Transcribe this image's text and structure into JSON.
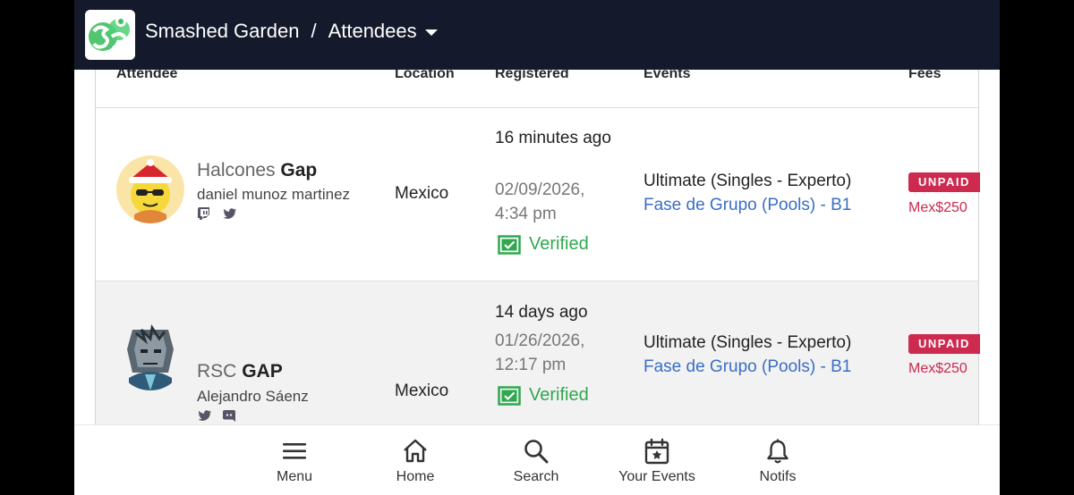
{
  "header": {
    "org": "Smashed Garden",
    "separator": "/",
    "section": "Attendees"
  },
  "table": {
    "columns": [
      "Attendee",
      "Location",
      "Registered",
      "Events",
      "Fees"
    ],
    "rows": [
      {
        "prefix": "Halcones",
        "gamertag": "Gap",
        "real_name": "daniel munoz martinez",
        "socials": [
          "twitch-icon",
          "twitter-icon"
        ],
        "location": "Mexico",
        "registered_relative": "16 minutes ago",
        "registered_date": "02/09/2026,",
        "registered_time": "4:34 pm",
        "verified": "Verified",
        "event": "Ultimate (Singles - Experto)",
        "phase": "Fase de Grupo (Pools) - B1",
        "status": "UNPAID",
        "fee": "Mex$250"
      },
      {
        "prefix": "RSC",
        "gamertag": "GAP",
        "real_name": "Alejandro Sáenz",
        "socials": [
          "twitter-icon",
          "discord-icon"
        ],
        "location": "Mexico",
        "registered_relative": "14 days ago",
        "registered_date": "01/26/2026,",
        "registered_time": "12:17 pm",
        "verified": "Verified",
        "event": "Ultimate (Singles - Experto)",
        "phase": "Fase de Grupo (Pools) - B1",
        "status": "UNPAID",
        "fee": "Mex$250"
      }
    ]
  },
  "nav": {
    "items": [
      {
        "label": "Menu",
        "icon": "menu-icon"
      },
      {
        "label": "Home",
        "icon": "home-icon"
      },
      {
        "label": "Search",
        "icon": "search-icon"
      },
      {
        "label": "Your Events",
        "icon": "calendar-star-icon"
      },
      {
        "label": "Notifs",
        "icon": "bell-icon"
      }
    ]
  },
  "colors": {
    "topbar": "#141a2b",
    "unpaid": "#cc2a4f",
    "verified": "#2fa84f",
    "link": "#3a6ec6"
  }
}
